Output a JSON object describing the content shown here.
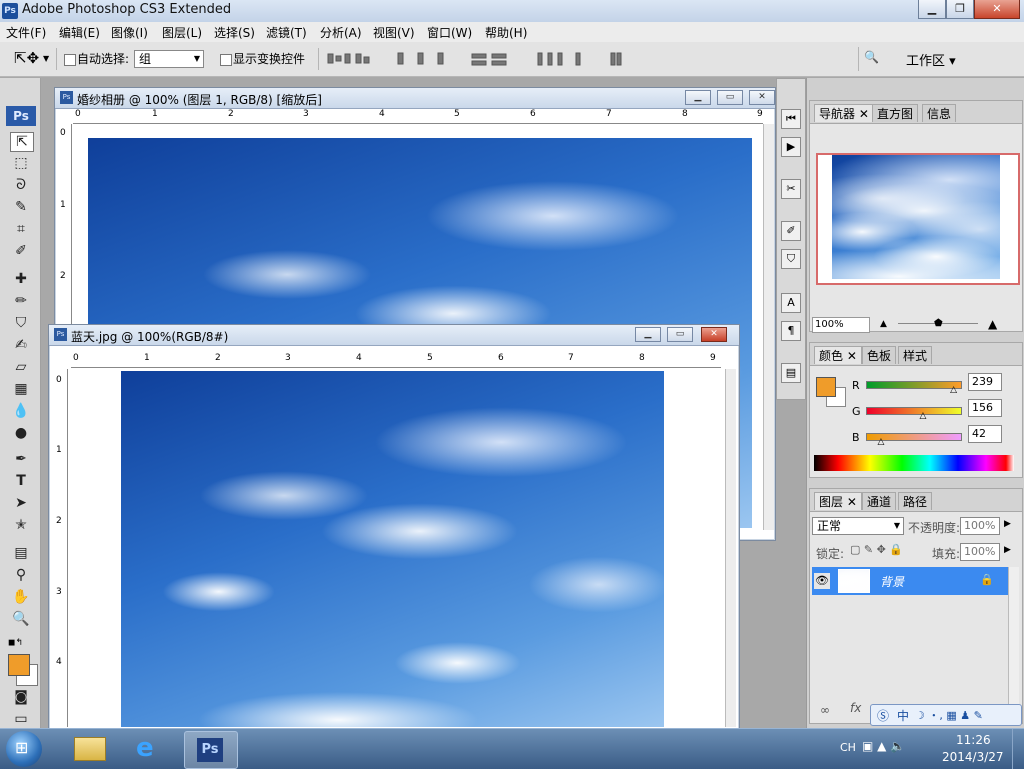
{
  "window": {
    "title": "Adobe Photoshop CS3 Extended",
    "app_icon": "Ps"
  },
  "menu": [
    "文件(F)",
    "编辑(E)",
    "图像(I)",
    "图层(L)",
    "选择(S)",
    "滤镜(T)",
    "分析(A)",
    "视图(V)",
    "窗口(W)",
    "帮助(H)"
  ],
  "options": {
    "auto_select_label": "自动选择:",
    "auto_select_value": "组",
    "show_transform_label": "显示变换控件",
    "workspace_label": "工作区"
  },
  "doc1": {
    "title": "婚纱相册 @ 100% (图层 1, RGB/8) [缩放后]",
    "ruler_h": [
      "0",
      "1",
      "2",
      "3",
      "4",
      "5",
      "6",
      "7",
      "8",
      "9"
    ],
    "ruler_v": [
      "0",
      "1",
      "2"
    ]
  },
  "doc2": {
    "title": "蓝天.jpg @ 100%(RGB/8#)",
    "ruler_h": [
      "0",
      "1",
      "2",
      "3",
      "4",
      "5",
      "6",
      "7",
      "8",
      "9"
    ],
    "ruler_v": [
      "0",
      "1",
      "2",
      "3",
      "4"
    ]
  },
  "navigator": {
    "tabs": [
      "导航器",
      "直方图",
      "信息"
    ],
    "zoom": "100%"
  },
  "color": {
    "tabs": [
      "颜色",
      "色板",
      "样式"
    ],
    "r_label": "R",
    "g_label": "G",
    "b_label": "B",
    "r": "239",
    "g": "156",
    "b": "42",
    "r_fraction": 0.937,
    "g_fraction": 0.612,
    "b_fraction": 0.165,
    "foreground": "#ef9c2a"
  },
  "layers": {
    "tabs": [
      "图层",
      "通道",
      "路径"
    ],
    "blend_mode": "正常",
    "opacity_label": "不透明度:",
    "opacity": "100%",
    "lock_label": "锁定:",
    "fill_label": "填充:",
    "fill": "100%",
    "layer_name": "背景"
  },
  "taskbar": {
    "lang": "CH",
    "time": "11:26",
    "date": "2014/3/27"
  },
  "ime": [
    "中"
  ]
}
